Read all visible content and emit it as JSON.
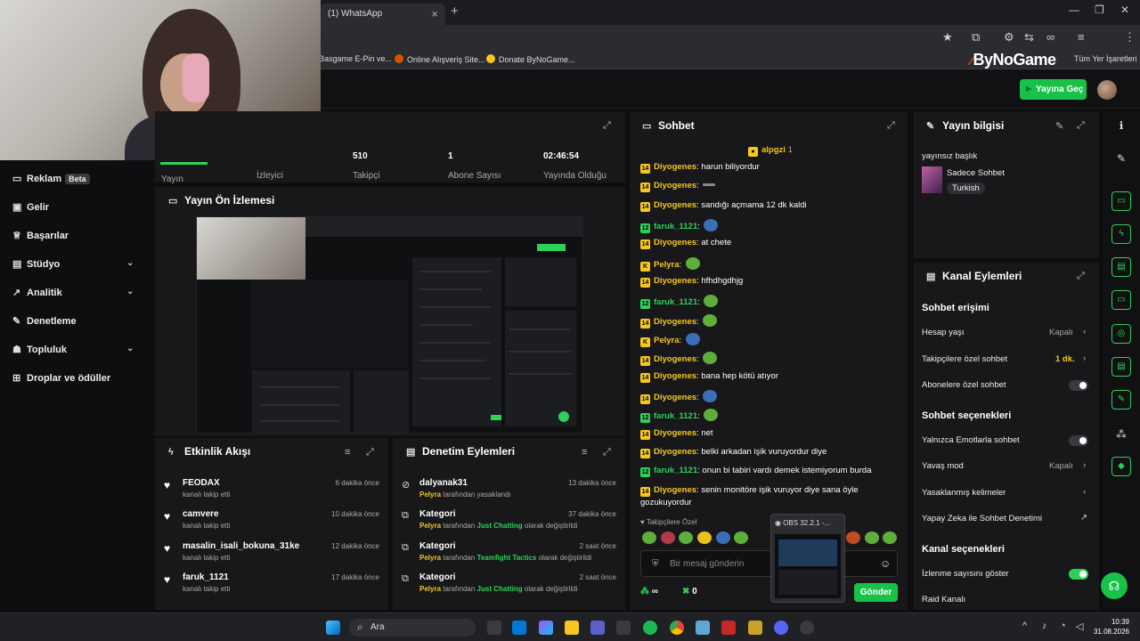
{
  "browser": {
    "tab_title": "(1) WhatsApp",
    "bookmarks": [
      "Basgame E-Pin ve...",
      "Online Alışveriş Site...",
      "Donate ByNoGame...",
      "Tüm Yer İşaretleri"
    ]
  },
  "site": {
    "logo": "ByNoGame",
    "go_live": "Yayına Geç"
  },
  "sidebar": {
    "items": [
      {
        "label": "Reklam",
        "badge": "Beta",
        "icon": "ad-icon"
      },
      {
        "label": "Gelir",
        "icon": "wallet-icon"
      },
      {
        "label": "Başarılar",
        "icon": "trophy-icon"
      },
      {
        "label": "Stüdyo",
        "icon": "studio-icon"
      },
      {
        "label": "Analitik",
        "icon": "analytics-icon"
      },
      {
        "label": "Denetleme",
        "icon": "wrench-icon"
      },
      {
        "label": "Topluluk",
        "icon": "community-icon"
      },
      {
        "label": "Droplar ve ödüller",
        "icon": "gift-icon"
      }
    ]
  },
  "stats": {
    "items": [
      {
        "value": "",
        "label": "Yayın"
      },
      {
        "value": "",
        "label": "İzleyici"
      },
      {
        "value": "510",
        "label": "Takipçi"
      },
      {
        "value": "1",
        "label": "Abone Sayısı"
      },
      {
        "value": "02:46:54",
        "label": "Yayında Olduğu"
      }
    ]
  },
  "preview": {
    "title": "Yayın Ön İzlemesi"
  },
  "activity": {
    "title": "Etkinlik Akışı",
    "items": [
      {
        "user": "FEODAX",
        "action": "kanalı takip etti",
        "time": "6 dakika önce"
      },
      {
        "user": "camvere",
        "action": "kanalı takip etti",
        "time": "10 dakika önce"
      },
      {
        "user": "masalin_isali_bokuna_31ke",
        "action": "kanalı takip etti",
        "time": "12 dakika önce"
      },
      {
        "user": "faruk_1121",
        "action": "kanalı takip etti",
        "time": "17 dakika önce"
      }
    ]
  },
  "moderation": {
    "title": "Denetim Eylemleri",
    "items": [
      {
        "title": "dalyanak31",
        "by": "Pelyra",
        "text": "tarafından yasaklandı",
        "category": "",
        "tail": "",
        "time": "13 dakika önce"
      },
      {
        "title": "Kategori",
        "by": "Pelyra",
        "text": "tarafından",
        "category": "Just Chatting",
        "tail": "olarak değiştirildi",
        "time": "37 dakika önce"
      },
      {
        "title": "Kategori",
        "by": "Pelyra",
        "text": "tarafından",
        "category": "Teamfight Tactics",
        "tail": "olarak değiştirildi",
        "time": "2 saat önce"
      },
      {
        "title": "Kategori",
        "by": "Pelyra",
        "text": "tarafından",
        "category": "Just Chatting",
        "tail": "olarak değiştirildi",
        "time": "2 saat önce"
      }
    ]
  },
  "chat": {
    "title": "Sohbet",
    "pinned_user": "alpgzi",
    "pinned_count": "1",
    "messages": [
      {
        "badge": "14",
        "user": "Diyogenes",
        "text": "harun biliyordur",
        "emote": false
      },
      {
        "badge": "14",
        "user": "Diyogenes",
        "text": "",
        "emote": true
      },
      {
        "badge": "14",
        "user": "Diyogenes",
        "text": "sandığı açmama 12 dk kaldi",
        "emote": false
      },
      {
        "badge": "12",
        "user": "faruk_1121",
        "text": "",
        "emote": true
      },
      {
        "badge": "14",
        "user": "Diyogenes",
        "text": "at chete",
        "emote": false
      },
      {
        "badge": "K",
        "user": "Pelyra",
        "text": "",
        "emote": true
      },
      {
        "badge": "14",
        "user": "Diyogenes",
        "text": "hfhdhgdhjg",
        "emote": false
      },
      {
        "badge": "12",
        "user": "faruk_1121",
        "text": "",
        "emote": true
      },
      {
        "badge": "14",
        "user": "Diyogenes",
        "text": "",
        "emote": true
      },
      {
        "badge": "K",
        "user": "Pelyra",
        "text": "",
        "emote": true
      },
      {
        "badge": "14",
        "user": "Diyogenes",
        "text": "",
        "emote": true
      },
      {
        "badge": "14",
        "user": "Diyogenes",
        "text": "bana hep kötü atıyor",
        "emote": false
      },
      {
        "badge": "14",
        "user": "Diyogenes",
        "text": "",
        "emote": true
      },
      {
        "badge": "12",
        "user": "faruk_1121",
        "text": "",
        "emote": true
      },
      {
        "badge": "14",
        "user": "Diyogenes",
        "text": "net",
        "emote": false
      },
      {
        "badge": "14",
        "user": "Diyogenes",
        "text": "belki arkadan işik vuruyordur diye",
        "emote": false
      },
      {
        "badge": "12",
        "user": "faruk_1121",
        "text": "onun bi tabiri vardı demek istemiyorum burda",
        "emote": false
      },
      {
        "badge": "14",
        "user": "Diyogenes",
        "text": "senin monitöre işik vuruyor diye sana öyle",
        "emote": false
      }
    ],
    "wrap_line": "gozukuyordur",
    "followers_only": "Takipçilere Özel",
    "input_placeholder": "Bir mesaj gönderin",
    "infinity": "∞",
    "points": "0",
    "send": "Gönder"
  },
  "obs": {
    "title": "OBS 32.2.1 -..."
  },
  "stream_info": {
    "title": "Yayın bilgisi",
    "stream_title": "yayınsız başlık",
    "category": "Sadece Sohbet",
    "language": "Turkish"
  },
  "channel_actions": {
    "title": "Kanal Eylemleri",
    "chat_access": "Sohbet erişimi",
    "account_age": "Hesap yaşı",
    "account_age_value": "Kapalı",
    "followers_chat": "Takipçilere özel sohbet",
    "followers_chat_value": "1 dk.",
    "subs_chat": "Abonelere özel sohbet",
    "chat_options": "Sohbet seçenekleri",
    "emote_only": "Yalnızca Emotlarla sohbet",
    "slow_mode": "Yavaş mod",
    "slow_mode_value": "Kapalı",
    "banned_words": "Yasaklanmış kelimeler",
    "ai_moderation": "Yapay Zeka ile Sohbet Denetimi",
    "channel_options": "Kanal seçenekleri",
    "show_viewers": "İzlenme sayısını göster",
    "raid": "Raid Kanalı"
  },
  "taskbar": {
    "search": "Ara",
    "time": "10:39",
    "date": "31.08.2026"
  },
  "colors": {
    "accent": "#18c248",
    "badge_gold": "#f6c81d",
    "panel": "#18181b"
  }
}
